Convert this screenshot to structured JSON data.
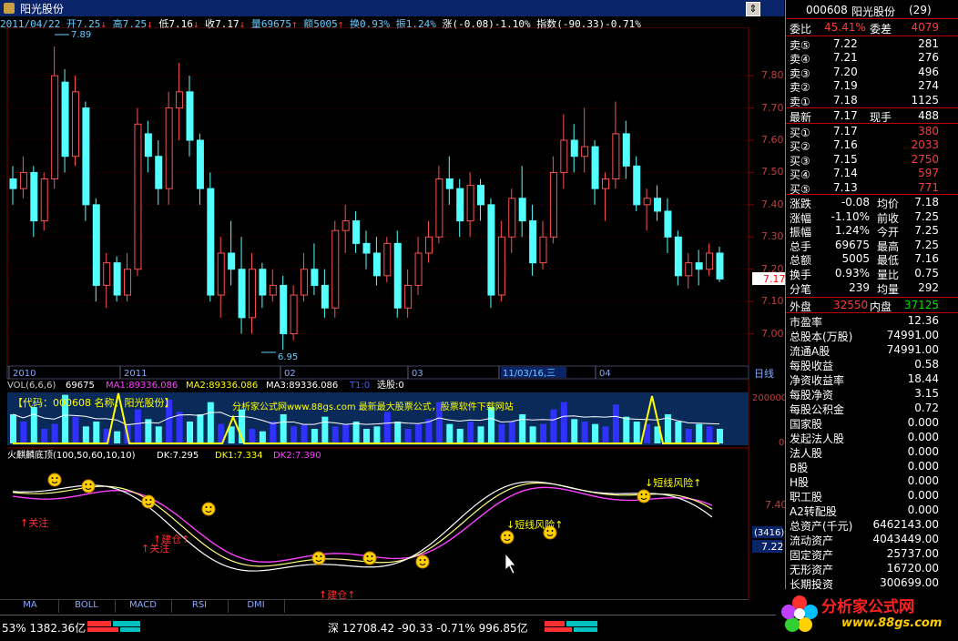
{
  "window": {
    "title": "阳光股份"
  },
  "info_line": {
    "date": "2011/04/22",
    "open": "开7.25",
    "high": "高7.25",
    "low": "低7.16",
    "close": "收7.17",
    "volume": "量69675",
    "amount": "额5005",
    "turnover": "换0.93%",
    "amplitude": "振1.24%",
    "change": "涨(-0.08)-1.10%",
    "index": "指数(-90.33)-0.71%"
  },
  "price_chart": {
    "high_label": "7.89",
    "low_label": "6.95",
    "y_ticks": [
      "7.80",
      "7.70",
      "7.60",
      "7.50",
      "7.40",
      "7.30",
      "7.20",
      "7.10",
      "7.00"
    ],
    "current_price": "7.17",
    "x_labels": [
      "2010",
      "2011",
      "02",
      "03",
      "11/03/16,三",
      "04"
    ],
    "period_button": "日线"
  },
  "chart_data": [
    {
      "type": "candlestick",
      "title": "",
      "ylim": [
        6.9,
        7.95
      ],
      "ohlc": [
        [
          7.48,
          7.52,
          7.4,
          7.45
        ],
        [
          7.45,
          7.55,
          7.42,
          7.5
        ],
        [
          7.5,
          7.52,
          7.3,
          7.35
        ],
        [
          7.35,
          7.5,
          7.32,
          7.48
        ],
        [
          7.48,
          7.89,
          7.45,
          7.8
        ],
        [
          7.78,
          7.82,
          7.5,
          7.55
        ],
        [
          7.55,
          7.8,
          7.52,
          7.75
        ],
        [
          7.7,
          7.72,
          7.35,
          7.4
        ],
        [
          7.4,
          7.42,
          7.1,
          7.15
        ],
        [
          7.15,
          7.25,
          7.08,
          7.22
        ],
        [
          7.22,
          7.24,
          7.1,
          7.12
        ],
        [
          7.12,
          7.25,
          7.1,
          7.2
        ],
        [
          7.2,
          7.7,
          7.18,
          7.65
        ],
        [
          7.62,
          7.66,
          7.5,
          7.55
        ],
        [
          7.55,
          7.6,
          7.4,
          7.45
        ],
        [
          7.45,
          7.75,
          7.4,
          7.7
        ],
        [
          7.7,
          7.84,
          7.6,
          7.75
        ],
        [
          7.75,
          7.8,
          7.55,
          7.6
        ],
        [
          7.6,
          7.62,
          7.4,
          7.45
        ],
        [
          7.45,
          7.5,
          7.1,
          7.12
        ],
        [
          7.12,
          7.3,
          7.05,
          7.25
        ],
        [
          7.25,
          7.35,
          7.15,
          7.2
        ],
        [
          7.2,
          7.3,
          7.0,
          7.05
        ],
        [
          7.05,
          7.25,
          7.0,
          7.2
        ],
        [
          7.2,
          7.22,
          7.08,
          7.12
        ],
        [
          7.12,
          7.2,
          7.1,
          7.15
        ],
        [
          7.15,
          7.18,
          6.95,
          7.0
        ],
        [
          7.0,
          7.15,
          6.98,
          7.12
        ],
        [
          7.12,
          7.25,
          7.1,
          7.2
        ],
        [
          7.2,
          7.28,
          7.12,
          7.15
        ],
        [
          7.15,
          7.2,
          7.05,
          7.08
        ],
        [
          7.08,
          7.35,
          7.05,
          7.32
        ],
        [
          7.32,
          7.4,
          7.25,
          7.35
        ],
        [
          7.35,
          7.38,
          7.25,
          7.28
        ],
        [
          7.28,
          7.32,
          7.2,
          7.25
        ],
        [
          7.25,
          7.3,
          7.15,
          7.18
        ],
        [
          7.18,
          7.3,
          7.16,
          7.28
        ],
        [
          7.28,
          7.32,
          7.05,
          7.08
        ],
        [
          7.08,
          7.2,
          7.05,
          7.15
        ],
        [
          7.15,
          7.3,
          7.12,
          7.25
        ],
        [
          7.25,
          7.35,
          7.22,
          7.3
        ],
        [
          7.3,
          7.52,
          7.28,
          7.48
        ],
        [
          7.48,
          7.55,
          7.4,
          7.45
        ],
        [
          7.45,
          7.48,
          7.3,
          7.35
        ],
        [
          7.35,
          7.5,
          7.3,
          7.46
        ],
        [
          7.46,
          7.48,
          7.35,
          7.4
        ],
        [
          7.4,
          7.42,
          7.08,
          7.12
        ],
        [
          7.12,
          7.35,
          7.1,
          7.3
        ],
        [
          7.3,
          7.45,
          7.25,
          7.42
        ],
        [
          7.42,
          7.52,
          7.3,
          7.35
        ],
        [
          7.35,
          7.4,
          7.18,
          7.22
        ],
        [
          7.22,
          7.35,
          7.2,
          7.3
        ],
        [
          7.3,
          7.55,
          7.28,
          7.5
        ],
        [
          7.5,
          7.68,
          7.45,
          7.6
        ],
        [
          7.6,
          7.65,
          7.5,
          7.55
        ],
        [
          7.55,
          7.7,
          7.5,
          7.58
        ],
        [
          7.58,
          7.6,
          7.4,
          7.45
        ],
        [
          7.45,
          7.5,
          7.35,
          7.48
        ],
        [
          7.48,
          7.72,
          7.45,
          7.62
        ],
        [
          7.62,
          7.66,
          7.48,
          7.52
        ],
        [
          7.52,
          7.55,
          7.38,
          7.4
        ],
        [
          7.4,
          7.45,
          7.32,
          7.42
        ],
        [
          7.42,
          7.46,
          7.35,
          7.38
        ],
        [
          7.38,
          7.42,
          7.25,
          7.3
        ],
        [
          7.3,
          7.32,
          7.15,
          7.18
        ],
        [
          7.18,
          7.25,
          7.14,
          7.22
        ],
        [
          7.22,
          7.26,
          7.15,
          7.2
        ],
        [
          7.2,
          7.28,
          7.18,
          7.25
        ],
        [
          7.25,
          7.27,
          7.16,
          7.17
        ]
      ]
    },
    {
      "type": "bar",
      "title": "VOL(6,6,6)",
      "legend": [
        "69675",
        "MA1:89336.086",
        "MA2:89336.086",
        "MA3:89336.086",
        "T1:0",
        "选股:0"
      ],
      "y_ticks": [
        "200000",
        "100000",
        "0"
      ],
      "values": [
        120,
        90,
        150,
        60,
        80,
        200,
        110,
        70,
        90,
        60,
        50,
        80,
        140,
        100,
        70,
        180,
        130,
        90,
        120,
        170,
        80,
        70,
        140,
        60,
        50,
        90,
        120,
        70,
        80,
        60,
        110,
        70,
        80,
        90,
        60,
        70,
        130,
        90,
        60,
        80,
        100,
        170,
        80,
        60,
        90,
        70,
        150,
        80,
        90,
        120,
        70,
        80,
        140,
        170,
        100,
        90,
        80,
        70,
        160,
        110,
        90,
        80,
        70,
        120,
        90,
        60,
        80,
        70,
        60
      ]
    },
    {
      "type": "line",
      "title": "火麒麟底顶(100,50,60,10,10)",
      "legend": [
        "DK:7.295",
        "DK1:7.334",
        "DK2:7.390"
      ],
      "y_ticks": [
        "7.40",
        "7.22"
      ],
      "readout": "(3416)",
      "annotations": [
        "关注",
        "建仓",
        "关注",
        "建仓",
        "短线风险",
        "短线风险"
      ]
    }
  ],
  "lower_panel": {
    "title": "火麒麟底顶(100,50,60,10,10)",
    "dk": "DK:7.295",
    "dk1": "DK1:7.334",
    "dk2": "DK2:7.390",
    "notes": {
      "attention1": "关注",
      "build1": "建仓",
      "attention2": "关注",
      "build2": "建仓",
      "risk1": "短线风险",
      "risk2": "短线风险"
    },
    "watermark_text": "分析家公式网www.88gs.com 最新最大股票公式，股票软件下载网站",
    "formula_text": "【代码：000608 名称：阳光股份】"
  },
  "quote_panel": {
    "code": "000608",
    "name": "阳光股份",
    "badge": "(29)",
    "webi_label": "委比",
    "webi_val": "45.41%",
    "weicha_label": "委差",
    "weicha_val": "4079",
    "asks": [
      {
        "label": "卖⑤",
        "price": "7.22",
        "vol": "281"
      },
      {
        "label": "卖④",
        "price": "7.21",
        "vol": "276"
      },
      {
        "label": "卖③",
        "price": "7.20",
        "vol": "496"
      },
      {
        "label": "卖②",
        "price": "7.19",
        "vol": "274"
      },
      {
        "label": "卖①",
        "price": "7.18",
        "vol": "1125"
      }
    ],
    "last_label": "最新",
    "last_val": "7.17",
    "hand_label": "现手",
    "hand_val": "488",
    "bids": [
      {
        "label": "买①",
        "price": "7.17",
        "vol": "380"
      },
      {
        "label": "买②",
        "price": "7.16",
        "vol": "2033"
      },
      {
        "label": "买③",
        "price": "7.15",
        "vol": "2750"
      },
      {
        "label": "买④",
        "price": "7.14",
        "vol": "597"
      },
      {
        "label": "买⑤",
        "price": "7.13",
        "vol": "771"
      }
    ],
    "stats": [
      {
        "l1": "涨跌",
        "v1": "-0.08",
        "l2": "均价",
        "v2": "7.18"
      },
      {
        "l1": "涨幅",
        "v1": "-1.10%",
        "l2": "前收",
        "v2": "7.25"
      },
      {
        "l1": "振幅",
        "v1": "1.24%",
        "l2": "今开",
        "v2": "7.25"
      },
      {
        "l1": "总手",
        "v1": "69675",
        "l2": "最高",
        "v2": "7.25"
      },
      {
        "l1": "总额",
        "v1": "5005",
        "l2": "最低",
        "v2": "7.16"
      },
      {
        "l1": "换手",
        "v1": "0.93%",
        "l2": "量比",
        "v2": "0.75"
      },
      {
        "l1": "分笔",
        "v1": "239",
        "l2": "均量",
        "v2": "292"
      }
    ],
    "outer_label": "外盘",
    "outer_val": "32550",
    "inner_label": "内盘",
    "inner_val": "37125",
    "finance": [
      {
        "k": "市盈率",
        "v": "12.36"
      },
      {
        "k": "总股本(万股)",
        "v": "74991.00"
      },
      {
        "k": "流通A股",
        "v": "74991.00"
      },
      {
        "k": "每股收益",
        "v": "0.58"
      },
      {
        "k": "净资收益率",
        "v": "18.44"
      },
      {
        "k": "每股净资",
        "v": "3.15"
      },
      {
        "k": "每股公积金",
        "v": "0.72"
      },
      {
        "k": "国家股",
        "v": "0.000"
      },
      {
        "k": "发起法人股",
        "v": "0.000"
      },
      {
        "k": "法人股",
        "v": "0.000"
      },
      {
        "k": "B股",
        "v": "0.000"
      },
      {
        "k": "H股",
        "v": "0.000"
      },
      {
        "k": "职工股",
        "v": "0.000"
      },
      {
        "k": "A2转配股",
        "v": "0.000"
      },
      {
        "k": "总资产(千元)",
        "v": "6462143.00"
      },
      {
        "k": "流动资产",
        "v": "4043449.00"
      },
      {
        "k": "固定资产",
        "v": "25737.00"
      },
      {
        "k": "无形资产",
        "v": "16720.00"
      },
      {
        "k": "长期投资",
        "v": "300699.00"
      }
    ]
  },
  "tabs": [
    "MA",
    "BOLL",
    "MACD",
    "RSI",
    "DMI"
  ],
  "statusbar": {
    "left": "53% 1382.36亿",
    "center": "深 12708.42 -90.33 -0.71% 996.85亿",
    "logo": "分析家公式网",
    "logo_url": "www.88gs.com"
  }
}
